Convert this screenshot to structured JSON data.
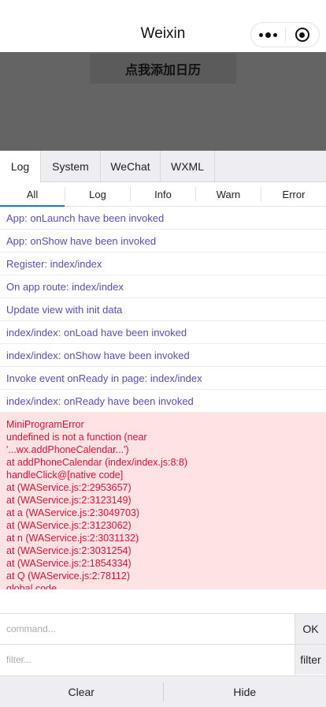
{
  "navbar": {
    "title": "Weixin",
    "more_icon": "more-dots-icon",
    "close_icon": "target-circle-icon"
  },
  "page": {
    "calendar_button_label": "点我添加日历"
  },
  "console": {
    "tabs": [
      {
        "label": "Log",
        "active": true
      },
      {
        "label": "System",
        "active": false
      },
      {
        "label": "WeChat",
        "active": false
      },
      {
        "label": "WXML",
        "active": false
      }
    ],
    "subtabs": [
      {
        "label": "All",
        "active": true
      },
      {
        "label": "Log",
        "active": false
      },
      {
        "label": "Info",
        "active": false
      },
      {
        "label": "Warn",
        "active": false
      },
      {
        "label": "Error",
        "active": false
      }
    ],
    "logs": [
      "App: onLaunch have been invoked",
      "App: onShow have been invoked",
      "Register: index/index",
      "On app route: index/index",
      "Update view with init data",
      "index/index: onLoad have been invoked",
      "index/index: onShow have been invoked",
      "Invoke event onReady in page: index/index",
      "index/index: onReady have been invoked"
    ],
    "error_lines": [
      "MiniProgramError",
      "undefined is not a function (near",
      "'...wx.addPhoneCalendar...')",
      "at addPhoneCalendar (index/index.js:8:8)",
      "handleClick@[native code]",
      "at (WAService.js:2:2953657)",
      "at (WAService.js:2:3123149)",
      "at a (WAService.js:2:3049703)",
      "at (WAService.js:2:3123062)",
      "at n (WAService.js:2:3031132)",
      "at (WAService.js:2:3031254)",
      "at (WAService.js:2:1854334)",
      "at Q (WAService.js:2:78112)",
      "global code"
    ],
    "command_placeholder": "command...",
    "command_button": "OK",
    "filter_placeholder": "filter...",
    "filter_button": "filter",
    "clear_label": "Clear",
    "hide_label": "Hide"
  },
  "colors": {
    "log_text": "#5b4cbd",
    "error_text": "#e0123a",
    "error_bg": "#ffe3e3",
    "overlay": "#646464",
    "tab_bg": "#eeedf2"
  }
}
